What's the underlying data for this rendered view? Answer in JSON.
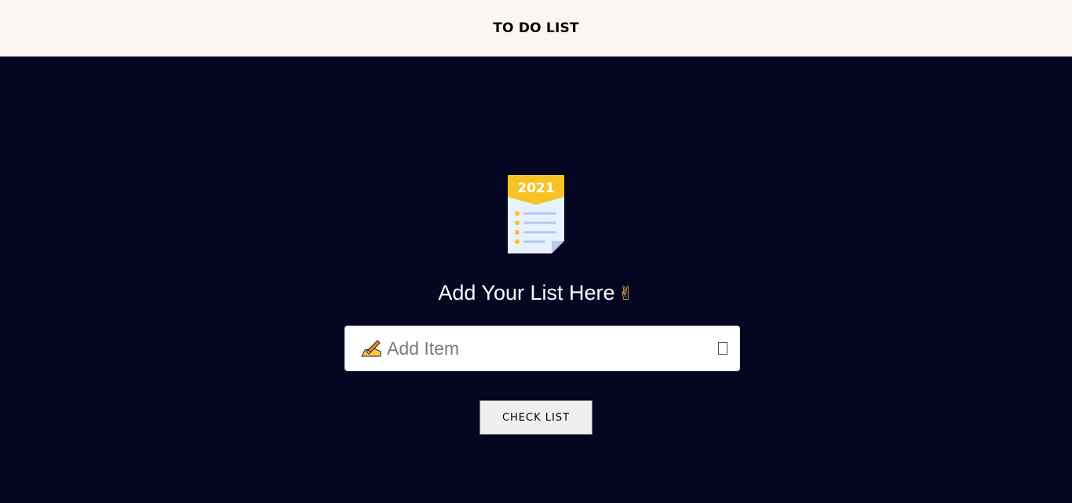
{
  "header": {
    "title": "TO DO LIST"
  },
  "logo": {
    "year": "2021",
    "icon": "checklist-icon"
  },
  "main": {
    "heading": "Add Your List Here",
    "heading_emoji": "✌"
  },
  "input": {
    "placeholder": "Add Item",
    "value": "",
    "leading_icon": "writing-hand-icon",
    "trailing_icon": "add-icon"
  },
  "button": {
    "label": "CHECK LIST"
  },
  "colors": {
    "background": "#050622",
    "header_background": "#faf6f1",
    "accent": "#f7c744"
  }
}
